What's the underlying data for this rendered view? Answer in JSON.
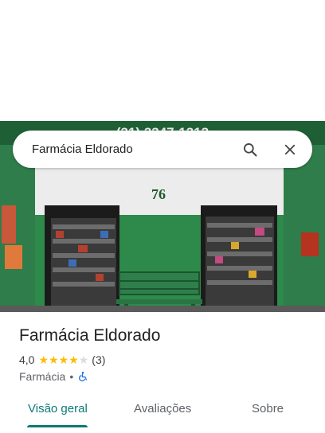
{
  "search": {
    "query": "Farmácia Eldorado"
  },
  "photo": {
    "phone_text": "(31) 3347-1313",
    "street_number": "76"
  },
  "place": {
    "title": "Farmácia Eldorado",
    "rating_value": "4,0",
    "rating_stars": 4,
    "review_count": "(3)",
    "category": "Farmácia",
    "separator": "•",
    "accessibility_icon": "wheelchair-icon"
  },
  "tabs": [
    {
      "label": "Visão geral",
      "active": true
    },
    {
      "label": "Avaliações",
      "active": false
    },
    {
      "label": "Sobre",
      "active": false
    }
  ],
  "colors": {
    "accent": "#0b7a75",
    "star": "#fbbc04",
    "storefront_green": "#2f7d4a"
  }
}
